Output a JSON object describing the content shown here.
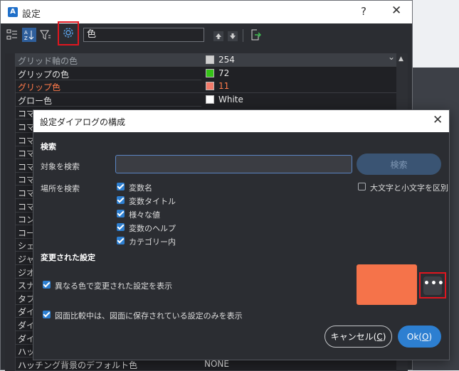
{
  "window": {
    "title": "設定",
    "help_glyph": "?",
    "close_glyph": "✕",
    "app_icon_letter": "A"
  },
  "toolbar": {
    "search_value": "色",
    "icons": [
      "categorized-view-icon",
      "alphabetical-view-icon",
      "filter-icon",
      "settings-gear-icon",
      "arrow-up-icon",
      "arrow-down-icon",
      "export-icon"
    ]
  },
  "table": {
    "rows": [
      {
        "name": "グリッド軸の色",
        "value": "254",
        "swatch": "#d0d0d0"
      },
      {
        "name": "グリップの色",
        "value": "72",
        "swatch": "#35c317"
      },
      {
        "name": "グリップ色",
        "value": "11",
        "swatch": "#f27a6a"
      },
      {
        "name": "グロー色",
        "value": "White",
        "swatch": "#ffffff"
      },
      {
        "name": "コマ"
      },
      {
        "name": "コマ"
      },
      {
        "name": "コマ"
      },
      {
        "name": "コマ"
      },
      {
        "name": "コマ"
      },
      {
        "name": "コマ"
      },
      {
        "name": "コマ"
      },
      {
        "name": "コマ"
      },
      {
        "name": "コン"
      },
      {
        "name": "コー"
      },
      {
        "name": "シェ"
      },
      {
        "name": "ジャ"
      },
      {
        "name": "ジオ"
      },
      {
        "name": "スナ"
      },
      {
        "name": "タブ"
      },
      {
        "name": "ダイ"
      },
      {
        "name": "ダイ"
      },
      {
        "name": "ダイ"
      },
      {
        "name": "ハッ"
      },
      {
        "name": "ハッチング背景のデフォルト色",
        "value": "NONE"
      }
    ]
  },
  "modal": {
    "title": "設定ダイアログの構成",
    "close_glyph": "✕",
    "search_section": "検索",
    "search_target_label": "対象を検索",
    "search_target_value": "",
    "search_button": "検索",
    "search_location_label": "場所を検索",
    "options": [
      "変数名",
      "変数タイトル",
      "様々な値",
      "変数のヘルプ",
      "カテゴリー内"
    ],
    "case_sensitive_label": "大文字と小文字を区別",
    "changed_section": "変更された設定",
    "show_changed_label": "異なる色で変更された設定を表示",
    "drawing_compare_label": "図面比較中は、図面に保存されている設定のみを表示",
    "highlight_color": "#f5734a",
    "ellipsis": "•••",
    "cancel_label": "キャンセル(",
    "cancel_key": "C",
    "cancel_close": ")",
    "ok_label": "Ok(",
    "ok_key": "O",
    "ok_close": ")"
  }
}
